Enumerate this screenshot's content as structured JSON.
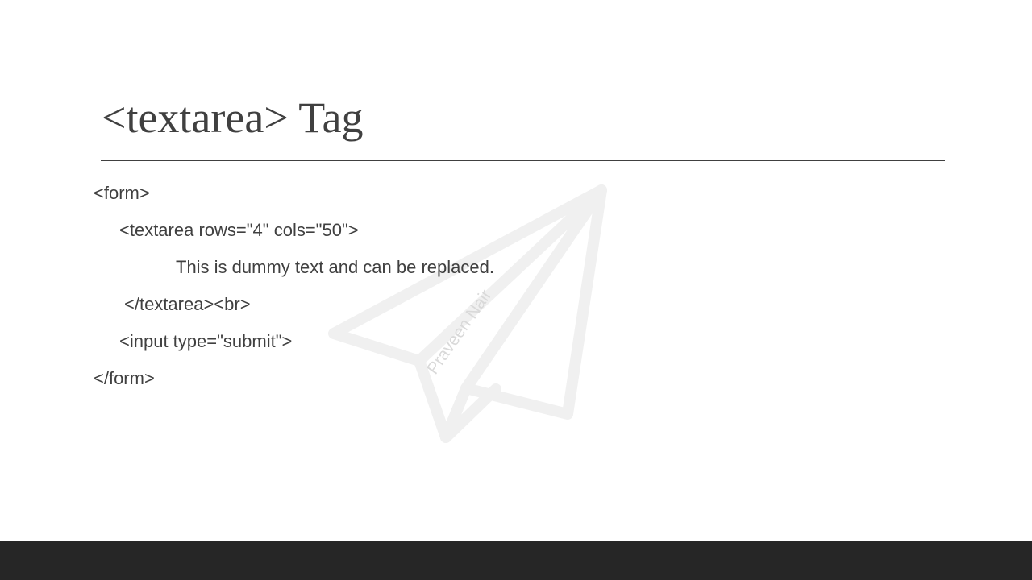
{
  "slide": {
    "title": "<textarea> Tag",
    "code_lines": [
      "<form>",
      "<textarea rows=\"4\" cols=\"50\">",
      "This is dummy text and can be replaced.",
      "</textarea><br>",
      "<input type=\"submit\">",
      "</form>"
    ],
    "watermark": {
      "icon": "paper-plane-icon",
      "text": "Praveen Nair",
      "color": "#f0f0f0",
      "text_color": "#d9d9d9"
    }
  },
  "colors": {
    "text": "#404040",
    "background": "#ffffff",
    "footer_bar": "#262626"
  }
}
